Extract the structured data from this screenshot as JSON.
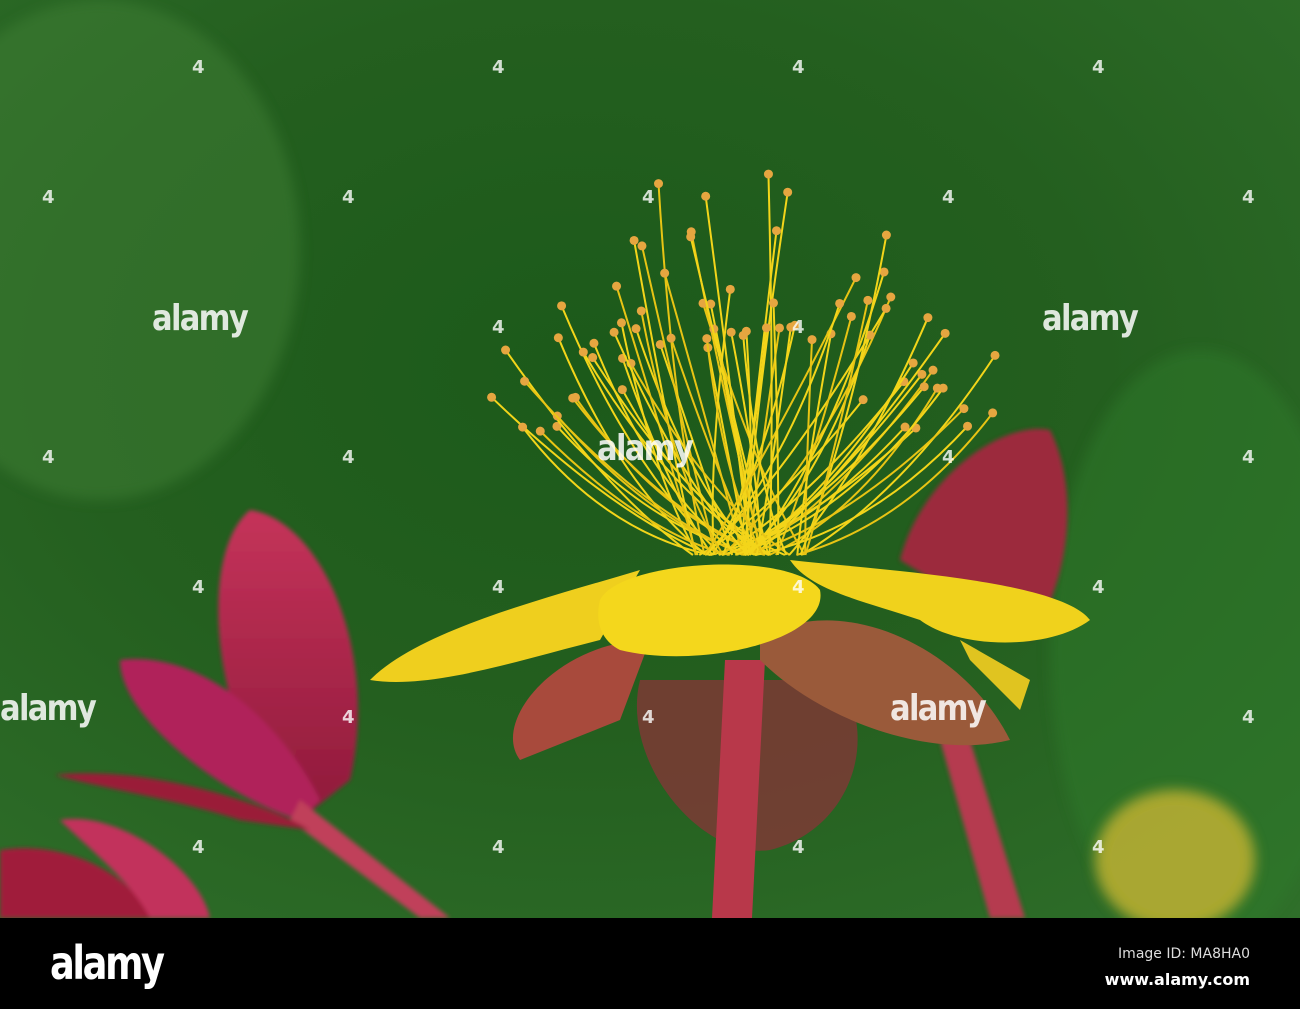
{
  "photo": {
    "subject": "Yellow St John's wort flower",
    "colors": {
      "background": "#1f5a1c",
      "petal": "#f2d21a",
      "stem": "#b8384a",
      "leaf": "#b2204a"
    }
  },
  "watermark": {
    "text": "alamy",
    "digit": "4"
  },
  "footer": {
    "logo": "alamy",
    "image_id": "Image ID: MA8HA0",
    "website": "www.alamy.com"
  }
}
